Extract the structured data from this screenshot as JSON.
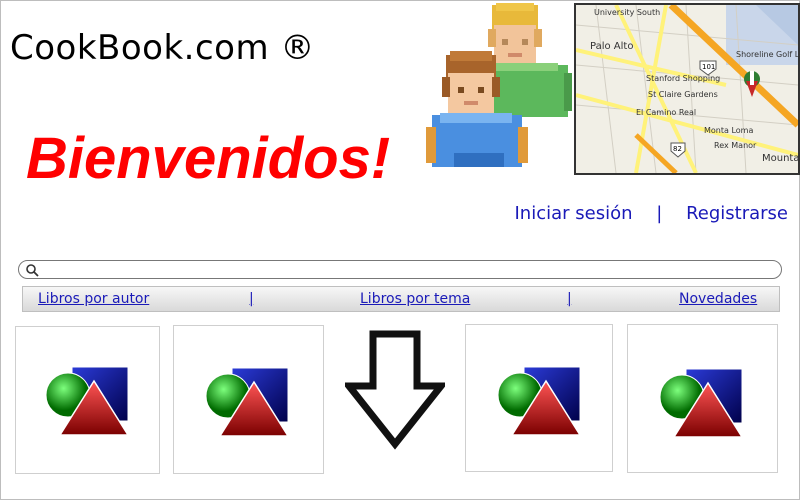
{
  "header": {
    "site_title": "CookBook.com ®",
    "welcome": "Bienvenidos!"
  },
  "auth": {
    "login": "Iniciar sesión",
    "separator": "|",
    "register": "Registrarse"
  },
  "search": {
    "placeholder": "",
    "icon": "magnifier-icon"
  },
  "nav": {
    "items": [
      "Libros por autor",
      "|",
      "Libros por tema",
      "|",
      "Novedades"
    ]
  },
  "map": {
    "labels": [
      "University South",
      "Palo Alto",
      "Stanford Shopping",
      "St Claire Gardens",
      "El Camino Real",
      "Shoreline Golf Links",
      "Monta Loma",
      "Rex Manor",
      "Mounta"
    ],
    "route_labels": [
      "101",
      "82"
    ],
    "colors": {
      "highway": "#f5a623",
      "road": "#fff27a",
      "land": "#f1efe6"
    }
  },
  "graphics": {
    "users": "users-icon",
    "book_cards": [
      "shapes-icon",
      "shapes-icon",
      "down-arrow-icon",
      "shapes-icon",
      "shapes-icon"
    ]
  },
  "colors": {
    "welcome": "#ff0000",
    "link": "#1a1ab8"
  }
}
